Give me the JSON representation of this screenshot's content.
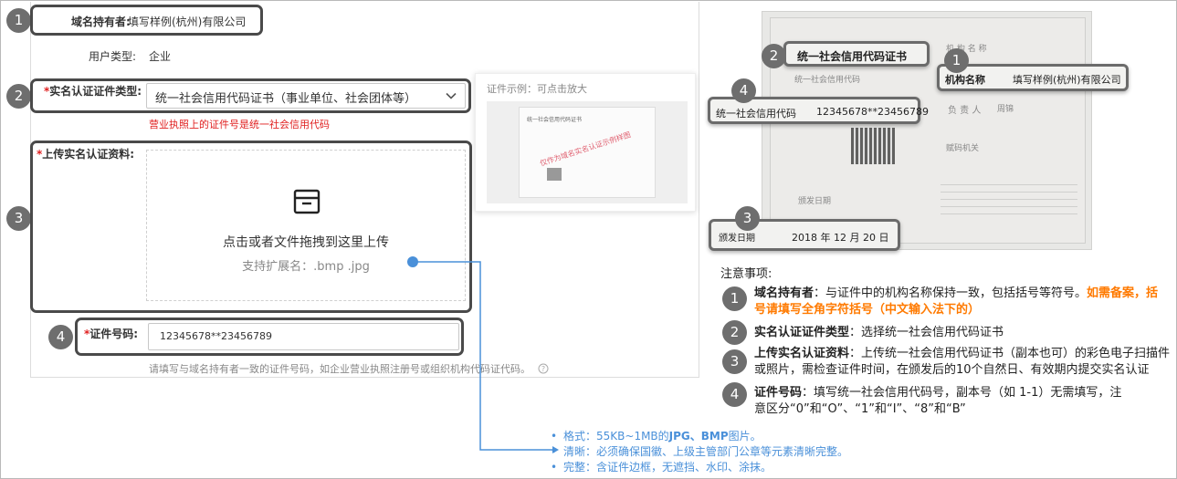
{
  "form": {
    "domain_holder_label": "域名持有者:",
    "domain_holder_value": "填写样例(杭州)有限公司",
    "user_type_label": "用户类型:",
    "user_type_value": "企业",
    "id_type_label": "实名认证证件类型:",
    "id_type_value": "统一社会信用代码证书（事业单位、社会团体等）",
    "id_type_error": "营业执照上的证件号是统一社会信用代码",
    "upload_label": "上传实名认证资料:",
    "upload_text": "点击或者文件拖拽到这里上传",
    "upload_ext": "支持扩展名：.bmp .jpg",
    "cert_no_label": "证件号码:",
    "cert_no_value": "12345678**23456789",
    "cert_no_hint": "请填写与域名持有者一致的证件号码，如企业营业执照注册号或组织机构代码证代码。"
  },
  "example": {
    "title": "证件示例：可点击放大",
    "cert_header": "统一社会信用代码证书",
    "watermark": "仅作为域名实名认证示例样图"
  },
  "certificate": {
    "title": "统一社会信用代码证书",
    "org_name_label": "机构名称",
    "org_name_value": "填写样例(杭州)有限公司",
    "code_label": "统一社会信用代码",
    "code_value": "12345678**23456789",
    "date_label": "颁发日期",
    "date_value": "2018 年 12 月  20 日",
    "ghost_org": "机 构 名 称",
    "ghost_code": "统一社会信用代码",
    "ghost_person": "负 责 人",
    "ghost_person_value": "周锦",
    "ghost_issuer": "赋码机关",
    "ghost_date": "颁发日期"
  },
  "steps": [
    "1",
    "2",
    "3",
    "4"
  ],
  "notes": {
    "title": "注意事项:",
    "items": [
      {
        "num": "1",
        "bold": "域名持有者",
        "text": "：与证件中的机构名称保持一致，包括括号等符号。",
        "orange": "如需备案，括号请填写全角字符括号（中文输入法下的）"
      },
      {
        "num": "2",
        "bold": "实名认证证件类型",
        "text": "：选择统一社会信用代码证书"
      },
      {
        "num": "3",
        "bold": "上传实名认证资料",
        "text": "：上传统一社会信用代码证书（副本也可）的彩色电子扫描件或照片，需检查证件时间，在颁发后的10个自然日、有效期内提交实名认证"
      },
      {
        "num": "4",
        "bold": "证件号码",
        "text": "：填写统一社会信用代码号，副本号（如 1-1）无需填写，注意区分“0”和“O”、“1”和“I”、“8”和“B”"
      }
    ]
  },
  "requirements": [
    {
      "label": "格式：",
      "pre": "55KB~1MB的",
      "bold": "JPG、BMP",
      "post": "图片。"
    },
    {
      "label": "清晰：",
      "pre": "必须确保国徽、上级主管部门公章等元素清晰完整。",
      "bold": "",
      "post": ""
    },
    {
      "label": "完整：",
      "pre": "含证件边框，无遮挡、水印、涂抹。",
      "bold": "",
      "post": ""
    }
  ],
  "colors": {
    "accent_blue": "#4a90d9",
    "error_red": "#e02020",
    "note_orange": "#ff7a00",
    "marker_gray": "#6e6e6e"
  }
}
